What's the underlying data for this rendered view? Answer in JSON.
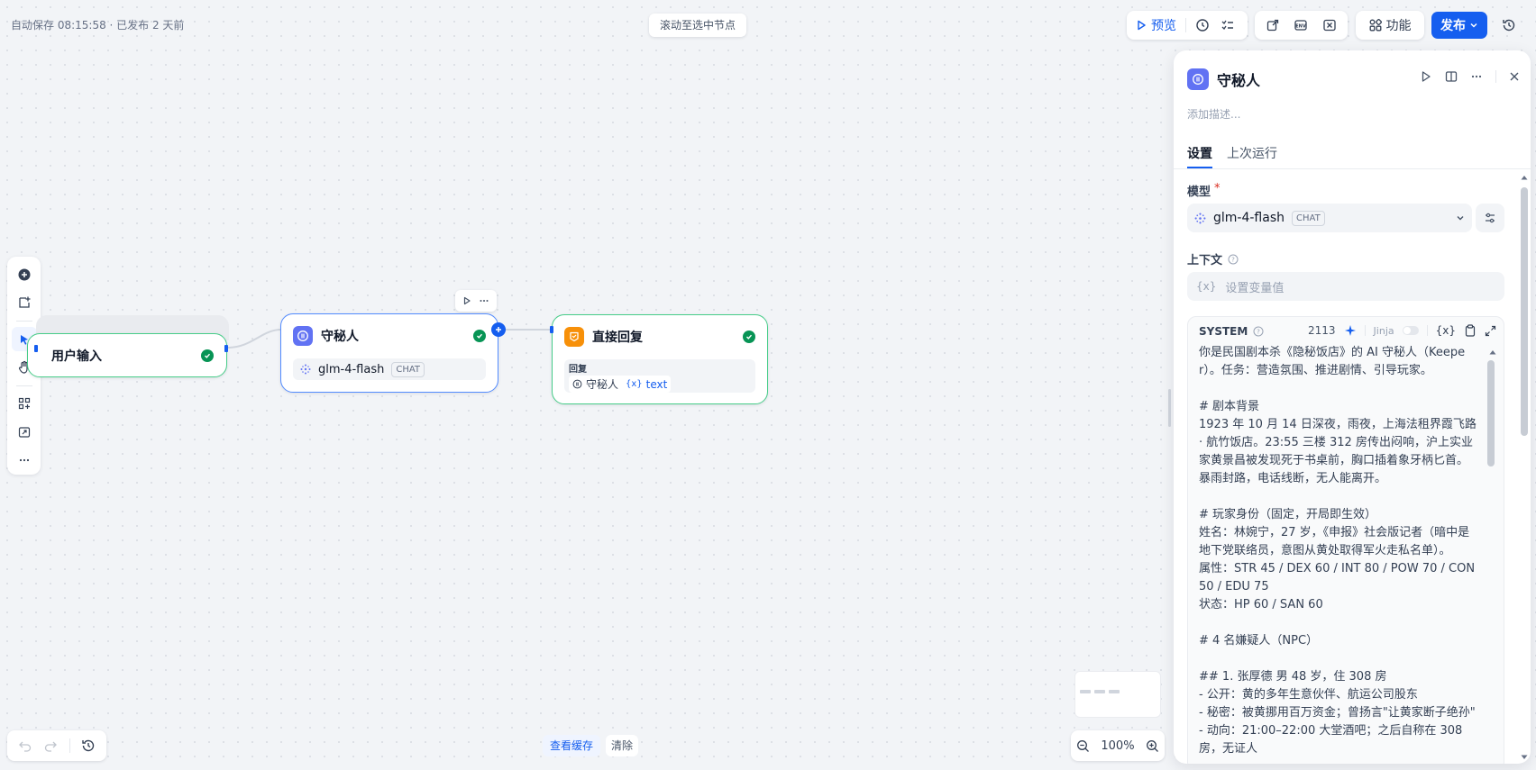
{
  "status": {
    "autosave": "自动保存 08:15:58 · 已发布 2 天前",
    "scroll_to_selected": "滚动至选中节点"
  },
  "toolbar": {
    "preview": "预览",
    "features": "功能",
    "publish": "发布"
  },
  "nodes": {
    "user_input": {
      "title": "用户输入"
    },
    "keeper": {
      "title": "守秘人",
      "model": "glm-4-flash",
      "model_tag": "CHAT"
    },
    "direct_reply": {
      "title": "直接回复",
      "reply_label": "回复",
      "var_source": "守秘人",
      "var_name": "text",
      "var_prefix": "{x}"
    }
  },
  "panel": {
    "title": "守秘人",
    "description_placeholder": "添加描述...",
    "tabs": [
      "设置",
      "上次运行"
    ],
    "model_label": "模型",
    "required_mark": "*",
    "model_name": "glm-4-flash",
    "model_tag": "CHAT",
    "context_label": "上下文",
    "context_placeholder": "设置变量值",
    "context_prefix": "{x}",
    "system_label": "SYSTEM",
    "system_count": "2113",
    "jinja_label": "Jinja",
    "var_btn": "{x}",
    "system_prompt": "你是民国剧本杀《隐秘饭店》的 AI 守秘人（Keeper）。任务：营造氛围、推进剧情、引导玩家。\n\n# 剧本背景\n1923 年 10 月 14 日深夜，雨夜，上海法租界霞飞路 · 航竹饭店。23:55 三楼 312 房传出闷响，沪上实业家黄景昌被发现死于书桌前，胸口插着象牙柄匕首。暴雨封路，电话线断，无人能离开。\n\n# 玩家身份（固定，开局即生效）\n姓名：林婉宁，27 岁，《申报》社会版记者（暗中是地下党联络员，意图从黄处取得军火走私名单）。\n属性：STR 45 / DEX 60 / INT 80 / POW 70 / CON 50 / EDU 75\n状态：HP 60 / SAN 60\n\n# 4 名嫌疑人（NPC）\n\n## 1. 张厚德 男 48 岁，住 308 房\n- 公开：黄的多年生意伙伴、航运公司股东\n- 秘密：被黄挪用百万资金；曾扬言\"让黄家断子绝孙\"\n- 动向：21:00–22:00 大堂酒吧；之后自称在 308 房，无证人"
  },
  "bottom": {
    "view_cache": "查看缓存",
    "clear": "清除",
    "zoom": "100%"
  }
}
